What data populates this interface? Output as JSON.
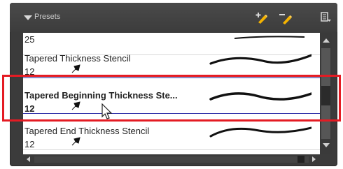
{
  "panel": {
    "title": "Presets",
    "accent_color": "#e41b23",
    "selection_color": "#3333aa"
  },
  "toolbar": {
    "icons": [
      "new-preset-icon",
      "edit-preset-icon",
      "menu-icon"
    ]
  },
  "presets": {
    "items": [
      {
        "name": "",
        "size": "25",
        "selected": false
      },
      {
        "name": "Tapered Thickness Stencil",
        "size": "12",
        "selected": false
      },
      {
        "name": "Tapered Beginning Thickness Ste...",
        "size": "12",
        "selected": true
      },
      {
        "name": "Tapered End Thickness Stencil",
        "size": "12",
        "selected": false
      }
    ]
  }
}
